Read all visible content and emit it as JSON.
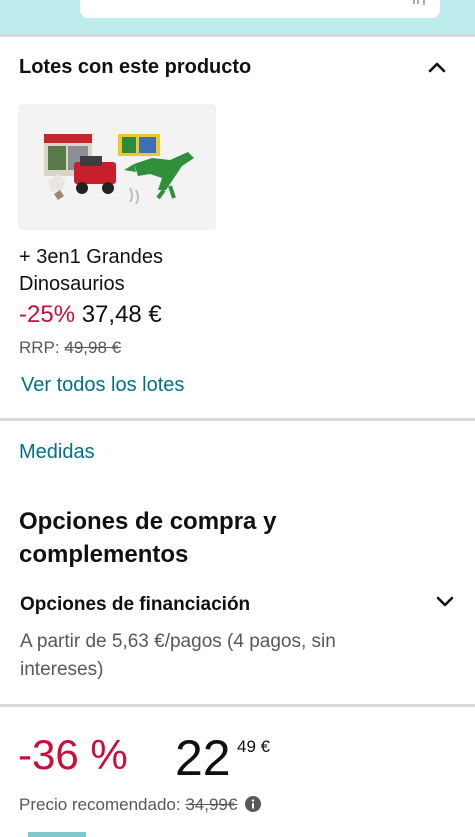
{
  "bundles": {
    "heading": "Lotes con este producto",
    "item": {
      "name": "+ 3en1 Grandes Dinosaurios",
      "discount": "-25%",
      "price": "37,48 €",
      "rrp_label": "RRP:",
      "rrp_value": "49,98 €"
    },
    "see_all": "Ver todos los lotes"
  },
  "measures": "Medidas",
  "purchase_options": {
    "title": "Opciones de compra y complementos",
    "financing_title": "Opciones de financiación",
    "financing_text": "A partir de 5,63 €/pagos (4 pagos, sin intereses)"
  },
  "price_block": {
    "discount": "-36 %",
    "price_int": "22",
    "price_frac": "49 €",
    "recommended_label": "Precio recomendado:",
    "recommended_value": "34,99€"
  },
  "icons": {
    "search": "search-icon",
    "collapse": "chevron-up-icon",
    "expand": "chevron-down-icon",
    "info": "info-icon"
  },
  "colors": {
    "link": "#007185",
    "discount": "#cc0c39",
    "header_bg": "#bdebeb",
    "divider": "#d5d9d9"
  }
}
